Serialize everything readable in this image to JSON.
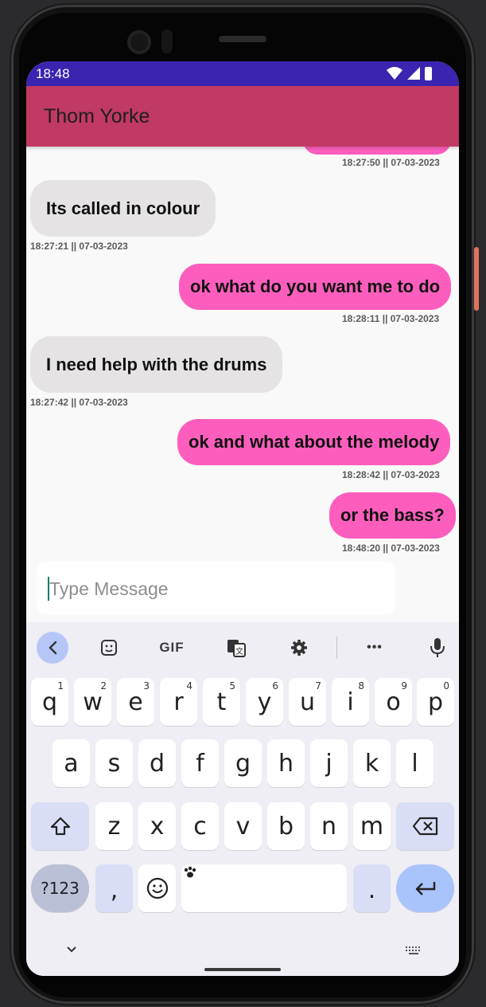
{
  "status_bar": {
    "time": "18:48"
  },
  "app_bar": {
    "title": "Thom Yorke"
  },
  "messages": [
    {
      "text": "",
      "timestamp": "18:27:50 || 07-03-2023",
      "direction": "out"
    },
    {
      "text": "Its called in colour",
      "timestamp": "18:27:21 || 07-03-2023",
      "direction": "in"
    },
    {
      "text": "ok what do you want me to do",
      "timestamp": "18:28:11 || 07-03-2023",
      "direction": "out"
    },
    {
      "text": "I need help with the drums",
      "timestamp": "18:27:42 || 07-03-2023",
      "direction": "in"
    },
    {
      "text": "ok and what about the melody",
      "timestamp": "18:28:42 || 07-03-2023",
      "direction": "out"
    },
    {
      "text": "or the bass?",
      "timestamp": "18:48:20 || 07-03-2023",
      "direction": "out"
    }
  ],
  "composer": {
    "placeholder": "Type Message",
    "value": ""
  },
  "keyboard": {
    "toolbar": {
      "back": "back-icon",
      "sticker": "sticker-icon",
      "gif": "GIF",
      "translate": "translate-icon",
      "settings": "gear-icon",
      "more": "•••",
      "mic": "mic-icon"
    },
    "row1": [
      {
        "label": "q",
        "hint": "1"
      },
      {
        "label": "w",
        "hint": "2"
      },
      {
        "label": "e",
        "hint": "3"
      },
      {
        "label": "r",
        "hint": "4"
      },
      {
        "label": "t",
        "hint": "5"
      },
      {
        "label": "y",
        "hint": "6"
      },
      {
        "label": "u",
        "hint": "7"
      },
      {
        "label": "i",
        "hint": "8"
      },
      {
        "label": "o",
        "hint": "9"
      },
      {
        "label": "p",
        "hint": "0"
      }
    ],
    "row2": [
      "a",
      "s",
      "d",
      "f",
      "g",
      "h",
      "j",
      "k",
      "l"
    ],
    "row3": [
      "z",
      "x",
      "c",
      "v",
      "b",
      "n",
      "m"
    ],
    "row4": {
      "symbols": "?123",
      "comma": ",",
      "period": "."
    }
  },
  "colors": {
    "status_bar": "#3b24b0",
    "app_bar": "#c03a63",
    "outgoing_bubble": "#fd5ebd",
    "incoming_bubble": "#e5e3e3"
  }
}
